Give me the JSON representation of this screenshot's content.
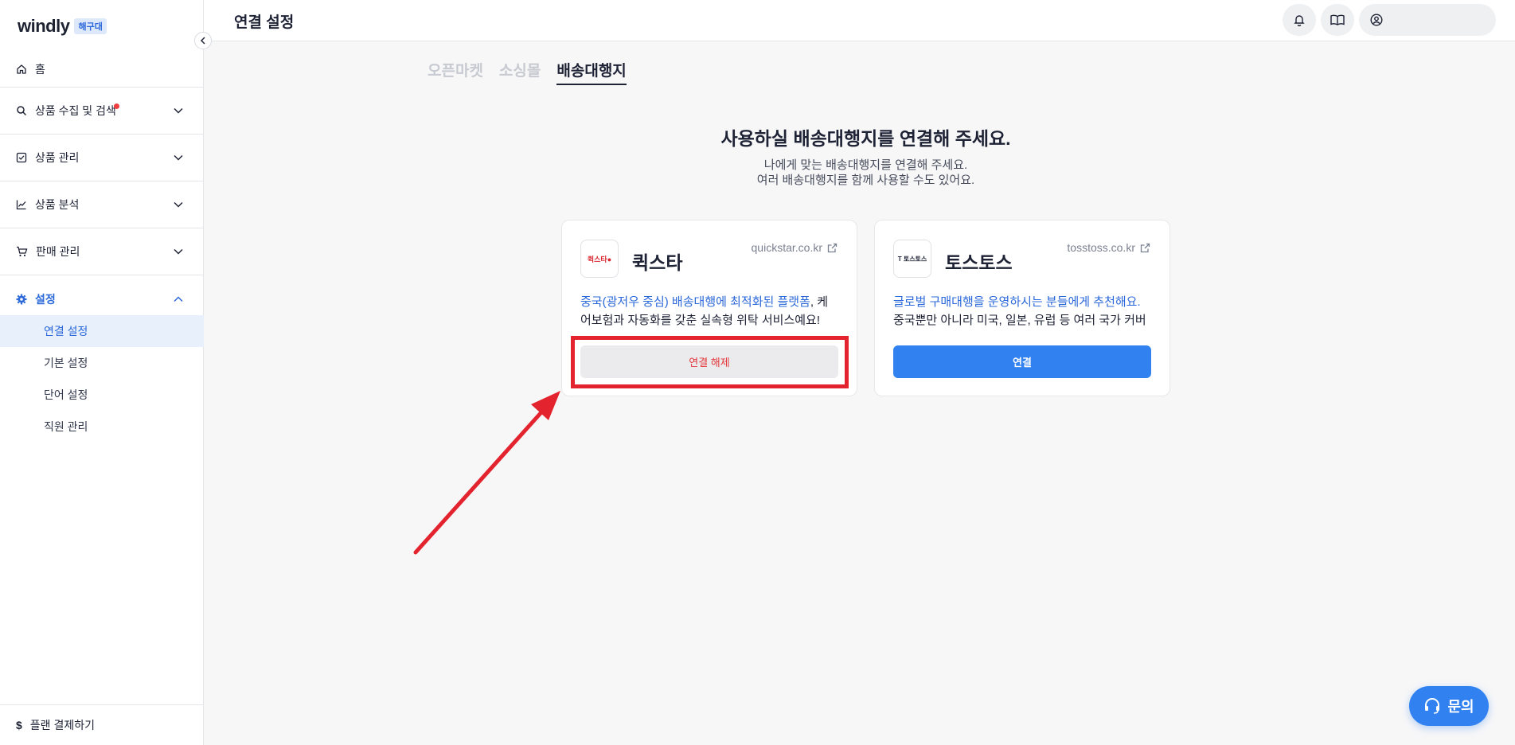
{
  "brand": {
    "logo": "windly",
    "badge": "해구대"
  },
  "sidebar": {
    "home": "홈",
    "sections": [
      {
        "label": "상품 수집 및 검색",
        "icon": "search-icon"
      },
      {
        "label": "상품 관리",
        "icon": "checkbox-icon"
      },
      {
        "label": "상품 분석",
        "icon": "chart-icon"
      },
      {
        "label": "판매 관리",
        "icon": "cart-icon"
      },
      {
        "label": "설정",
        "icon": "gear-icon"
      }
    ],
    "sub_items": [
      "연결 설정",
      "기본 설정",
      "단어 설정",
      "직원 관리"
    ],
    "bottom": "플랜 결제하기"
  },
  "header": {
    "title": "연결 설정"
  },
  "tabs": [
    "오픈마켓",
    "소싱몰",
    "배송대행지"
  ],
  "main": {
    "headline": "사용하실 배송대행지를 연결해 주세요.",
    "sub1": "나에게 맞는 배송대행지를 연결해 주세요.",
    "sub2": "여러 배송대행지를 함께 사용할 수도 있어요."
  },
  "cards": [
    {
      "name": "퀵스타",
      "logo_text": "퀵스타●",
      "link": "quickstar.co.kr",
      "desc_highlight": "중국(광저우 중심) 배송대행에 최적화된 플랫폼",
      "desc_rest": ", 케",
      "desc_line2": "어보험과 자동화를 갖춘 실속형 위탁 서비스예요!",
      "button": "연결 해제"
    },
    {
      "name": "토스토스",
      "logo_text": "T 토스토스",
      "link": "tosstoss.co.kr",
      "desc_highlight": "글로벌 구매대행을 운영하시는 분들에게 추천해요.",
      "desc_line2": "중국뿐만 아니라 미국, 일본, 유럽 등 여러 국가 커버",
      "button": "연결"
    }
  ],
  "help": {
    "label": "문의"
  },
  "colors": {
    "accent": "#3182f0",
    "danger": "#e3363a",
    "annotation": "#e3232e"
  }
}
